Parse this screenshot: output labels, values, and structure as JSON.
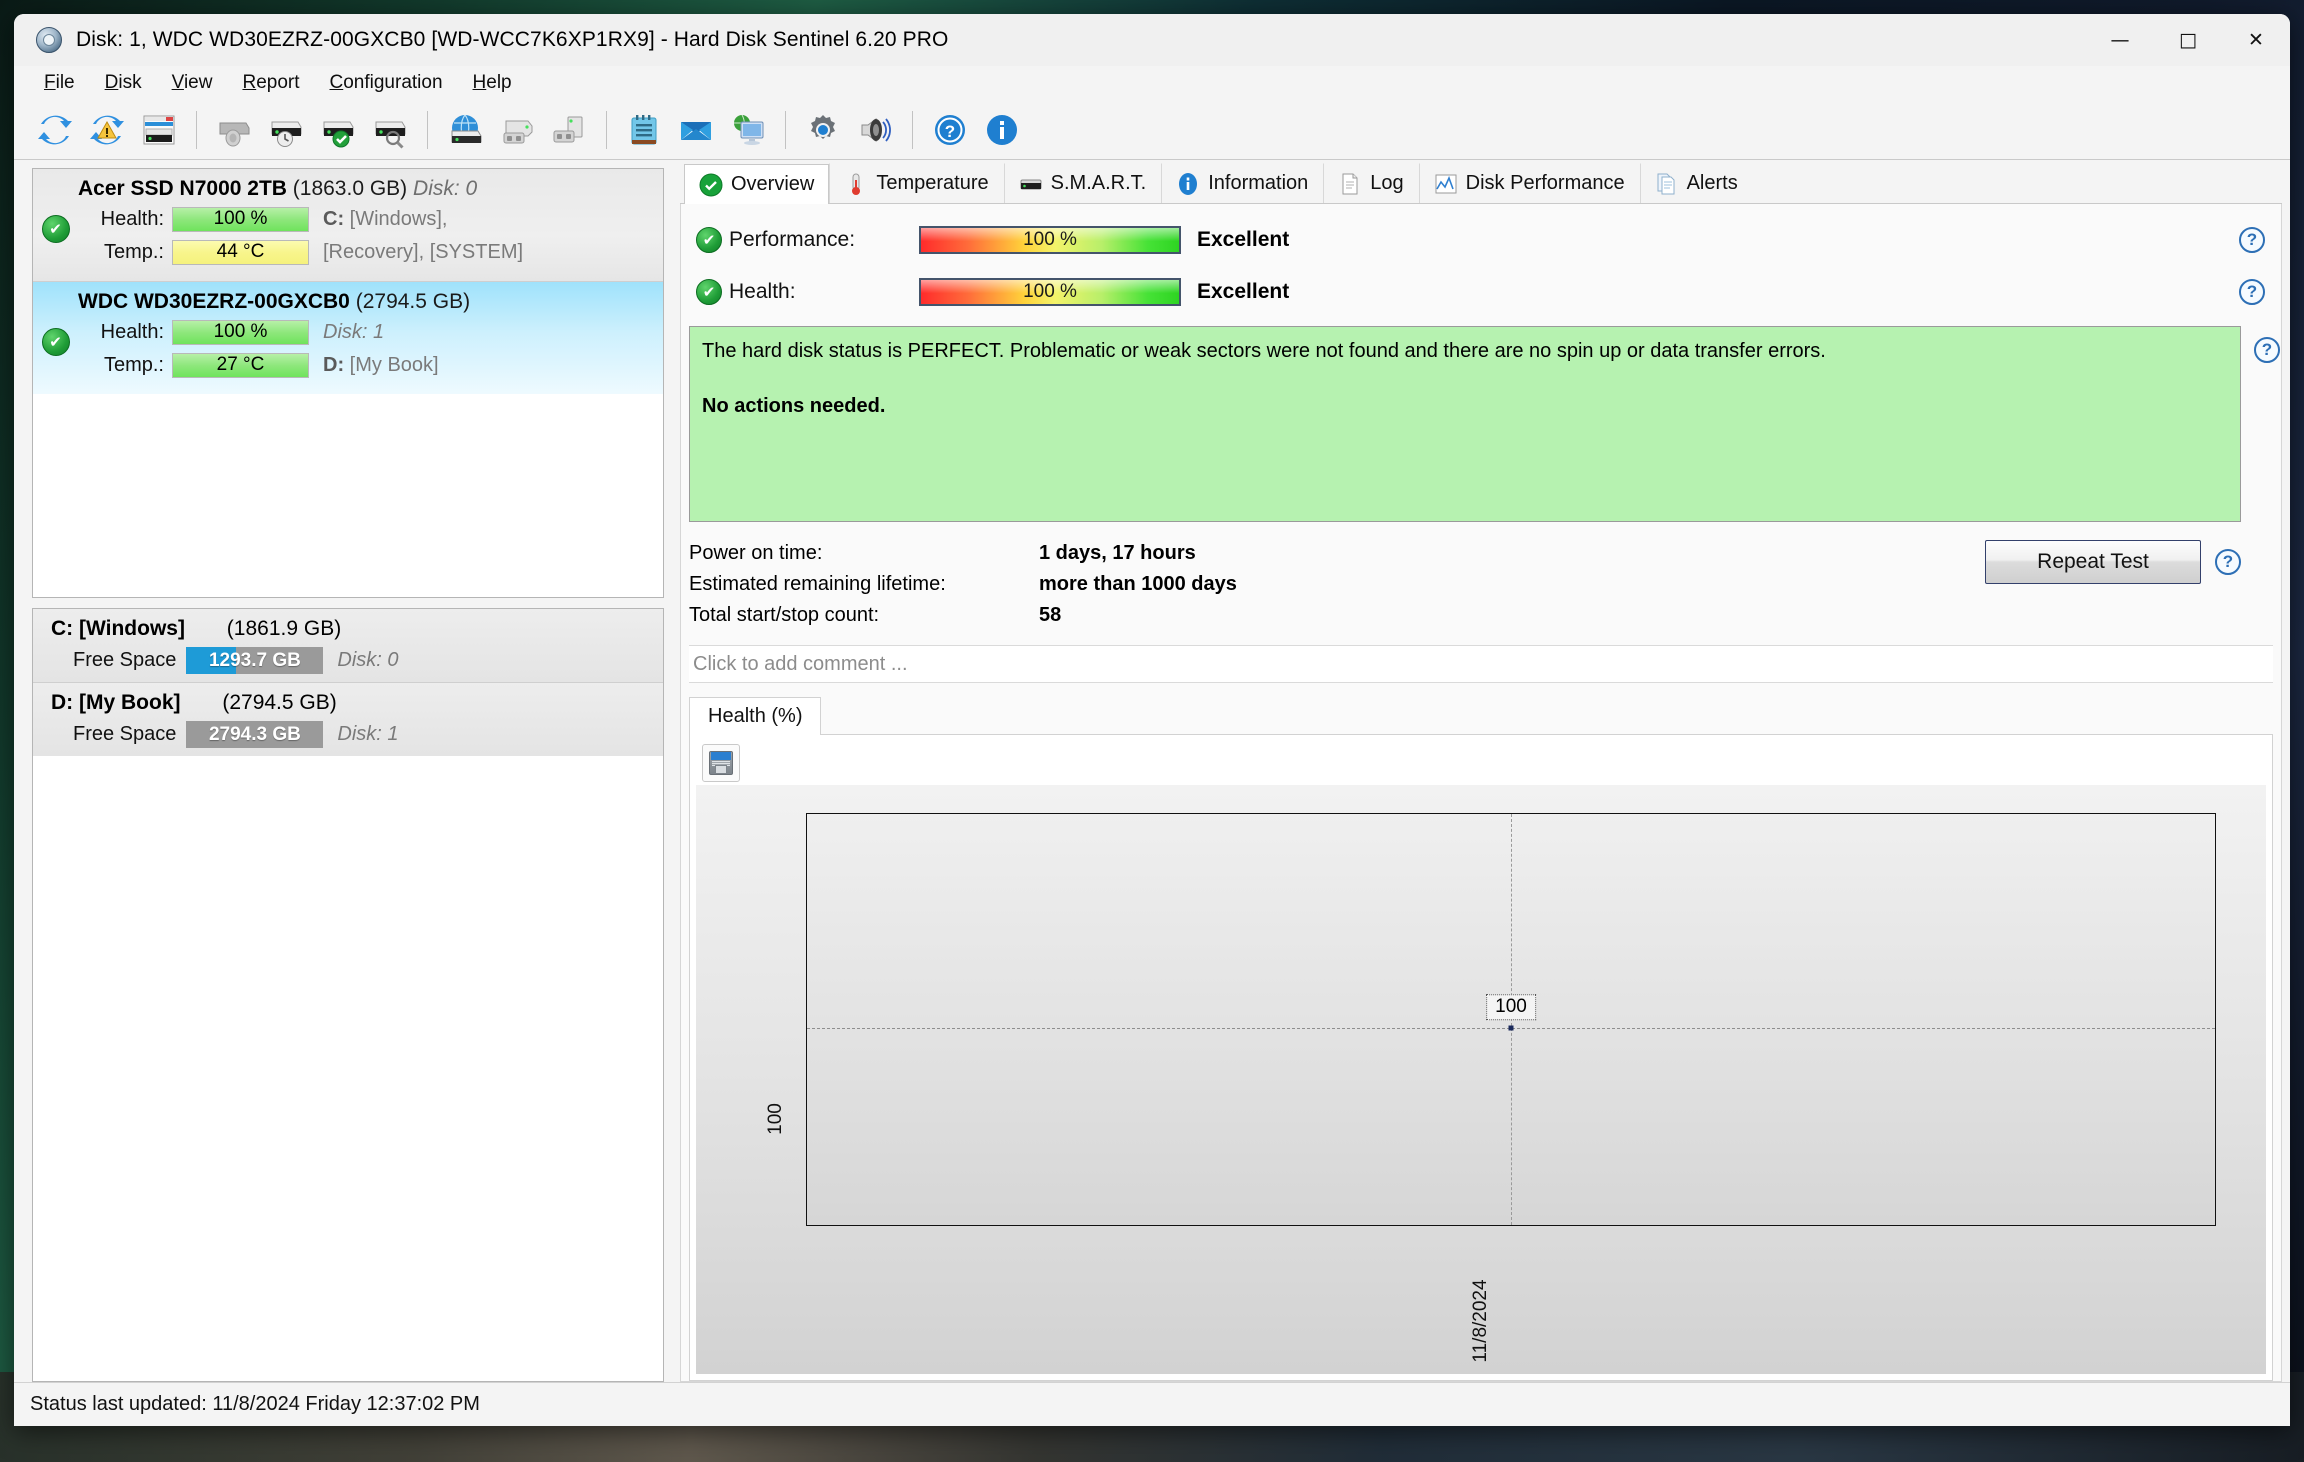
{
  "window": {
    "title": "Disk: 1, WDC WD30EZRZ-00GXCB0 [WD-WCC7K6XP1RX9]  -  Hard Disk Sentinel 6.20 PRO",
    "title_icon": "hard-disk-icon",
    "minimize": "—",
    "maximize": "□",
    "close": "✕"
  },
  "menu": [
    {
      "label": "File",
      "accel": "F"
    },
    {
      "label": "Disk",
      "accel": "D"
    },
    {
      "label": "View",
      "accel": "V"
    },
    {
      "label": "Report",
      "accel": "R"
    },
    {
      "label": "Configuration",
      "accel": "C"
    },
    {
      "label": "Help",
      "accel": "H"
    }
  ],
  "toolbar": [
    {
      "name": "refresh-icon",
      "group": 1
    },
    {
      "name": "refresh-alert-icon",
      "group": 1
    },
    {
      "name": "disk-panel-icon",
      "group": 1
    },
    {
      "name": "disk-mute-icon",
      "group": 2
    },
    {
      "name": "disk-schedule-icon",
      "group": 2
    },
    {
      "name": "disk-ok-icon",
      "group": 2
    },
    {
      "name": "disk-search-icon",
      "group": 2
    },
    {
      "name": "network-disk-icon",
      "group": 3
    },
    {
      "name": "backup-disk-icon",
      "group": 3
    },
    {
      "name": "clone-disk-icon",
      "group": 3
    },
    {
      "name": "notepad-icon",
      "group": 4
    },
    {
      "name": "mail-icon",
      "group": 4
    },
    {
      "name": "remote-monitor-icon",
      "group": 4
    },
    {
      "name": "settings-gear-icon",
      "group": 5
    },
    {
      "name": "sound-alert-icon",
      "group": 5
    },
    {
      "name": "help-icon",
      "group": 6
    },
    {
      "name": "info-icon",
      "group": 6
    }
  ],
  "sidebar": {
    "disks": [
      {
        "model": "Acer SSD N7000 2TB",
        "capacity": "(1863.0 GB)",
        "disk_no": "Disk: 0",
        "disk_no_inline": true,
        "health_label": "Health:",
        "health_value": "100 %",
        "temp_label": "Temp.:",
        "temp_value": "44 °C",
        "temp_color": "yellow",
        "extra_line1": "C: [Windows],",
        "extra_line2": "[Recovery],  [SYSTEM]",
        "selected": false
      },
      {
        "model": "WDC WD30EZRZ-00GXCB0",
        "capacity": "(2794.5 GB)",
        "disk_no": "",
        "disk_no_inline": false,
        "health_label": "Health:",
        "health_value": "100 %",
        "temp_label": "Temp.:",
        "temp_value": "27 °C",
        "temp_color": "green",
        "extra_line1": "Disk: 1",
        "extra_line2": "D: [My Book]",
        "selected": true
      }
    ],
    "volumes": [
      {
        "letter": "C: [Windows]",
        "capacity": "(1861.9 GB)",
        "free_label": "Free Space",
        "free_value": "1293.7 GB",
        "free_percent": 30,
        "disk_no": "Disk: 0"
      },
      {
        "letter": "D: [My Book]",
        "capacity": "(2794.5 GB)",
        "free_label": "Free Space",
        "free_value": "2794.3 GB",
        "free_percent": 0,
        "disk_no": "Disk: 1"
      }
    ]
  },
  "tabs": [
    {
      "label": "Overview",
      "icon": "green-check-icon",
      "active": true
    },
    {
      "label": "Temperature",
      "icon": "thermometer-icon",
      "active": false
    },
    {
      "label": "S.M.A.R.T.",
      "icon": "hard-disk-icon",
      "active": false
    },
    {
      "label": "Information",
      "icon": "info-icon",
      "active": false
    },
    {
      "label": "Log",
      "icon": "document-icon",
      "active": false
    },
    {
      "label": "Disk Performance",
      "icon": "chart-icon",
      "active": false
    },
    {
      "label": "Alerts",
      "icon": "documents-icon",
      "active": false
    }
  ],
  "overview": {
    "performance_label": "Performance:",
    "performance_value": "100 %",
    "performance_verdict": "Excellent",
    "health_label": "Health:",
    "health_value": "100 %",
    "health_verdict": "Excellent",
    "status_text": "The hard disk status is PERFECT. Problematic or weak sectors were not found and there are no spin up or data transfer errors.",
    "status_action": "No actions needed.",
    "status_bg": "#b6f2b0",
    "info_labels": [
      "Power on time:",
      "Estimated remaining lifetime:",
      "Total start/stop count:"
    ],
    "info_values": [
      "1 days, 17 hours",
      "more than 1000 days",
      "58"
    ],
    "repeat_button": "Repeat Test",
    "comment_placeholder": "Click to add comment ...",
    "help_symbol": "?"
  },
  "chart_data": {
    "type": "line",
    "title": "Health (%)",
    "tab_label": "Health (%)",
    "save_icon": "save-floppy-icon",
    "x": [
      "11/8/2024"
    ],
    "values": [
      100
    ],
    "categories": [
      "11/8/2024"
    ],
    "point_label": "100",
    "ytick_labels": [
      "100"
    ],
    "xtick_labels": [
      "11/8/2024"
    ],
    "ylabel": "",
    "xlabel": "",
    "ylim": [
      0,
      110
    ],
    "grid": true,
    "legend": "none"
  },
  "statusbar": {
    "text": "Status last updated: 11/8/2024 Friday 12:37:02 PM"
  }
}
